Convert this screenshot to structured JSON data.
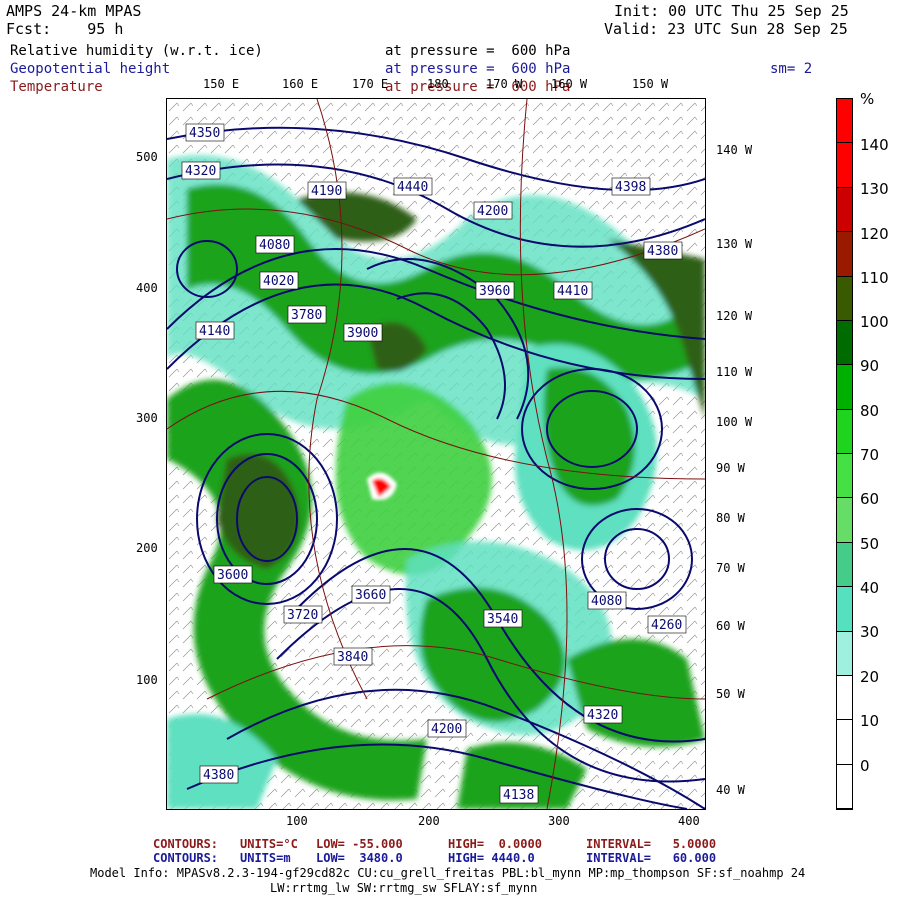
{
  "header": {
    "model": "AMPS 24-km MPAS",
    "fcst": "Fcst:    95 h",
    "init": "Init: 00 UTC Thu 25 Sep 25",
    "valid": "Valid: 23 UTC Sun 28 Sep 25",
    "smoothing": "sm= 2"
  },
  "fields": [
    {
      "name": "Relative humidity (w.r.t. ice)",
      "level": "at pressure =  600 hPa",
      "color": "#000000"
    },
    {
      "name": "Geopotential height",
      "level": "at pressure =  600 hPa",
      "color": "#1a1a9a"
    },
    {
      "name": "Temperature",
      "level": "at pressure =  600 hPa",
      "color": "#8b1a1a"
    }
  ],
  "map": {
    "top_lon_labels": [
      "150 E",
      "160 E",
      "170 E",
      "180",
      "170 W",
      "160 W",
      "150 W"
    ],
    "right_lon_labels": [
      "140 W",
      "130 W",
      "120 W",
      "110 W",
      "100 W",
      "90 W",
      "80 W",
      "70 W",
      "60 W",
      "50 W",
      "40 W"
    ],
    "y_ticks": [
      "500",
      "400",
      "300",
      "200",
      "100"
    ],
    "x_ticks": [
      "100",
      "200",
      "300",
      "400"
    ],
    "height_labels": [
      "4350",
      "4320",
      "4380",
      "4190",
      "4440",
      "4200",
      "4080",
      "4020",
      "4140",
      "3780",
      "3900",
      "3960",
      "3840",
      "3660",
      "3720",
      "3600",
      "3540",
      "4260",
      "4398",
      "4320",
      "4080",
      "4200",
      "4380",
      "4410",
      "4138"
    ],
    "colors": {
      "green_dark": "#2e5f12",
      "green_mid": "#1aa31a",
      "green_light": "#3ecf3e",
      "aqua": "#5fe0c0",
      "contour": "#0a0a6e",
      "temp": "#7a1010"
    }
  },
  "colorbar": {
    "unit": "%",
    "labels": [
      "140",
      "130",
      "120",
      "110",
      "100",
      "90",
      "80",
      "70",
      "60",
      "50",
      "40",
      "30",
      "20",
      "10",
      "0"
    ],
    "segments": [
      "#ff0000",
      "#ff0000",
      "#cc0000",
      "#9a1a00",
      "#3a5a00",
      "#006b00",
      "#00b000",
      "#1ed41e",
      "#44e044",
      "#66dd66",
      "#44cc88",
      "#55e0c0",
      "#a0f0e0",
      "#ffffff",
      "#ffffff",
      "#ffffff"
    ]
  },
  "footer": {
    "line1_label": "CONTOURS:",
    "line1_units": "UNITS=°C",
    "line1_low": "LOW= -55.000",
    "line1_high": "HIGH=  0.0000",
    "line1_interval": "INTERVAL=   5.0000",
    "line2_label": "CONTOURS:",
    "line2_units": "UNITS=m",
    "line2_low": "LOW=  3480.0",
    "line2_high": "HIGH= 4440.0",
    "line2_interval": "INTERVAL=   60.000",
    "model_info": "Model Info: MPASv8.2.3-194-gf29cd82c CU:cu_grell_freitas PBL:bl_mynn MP:mp_thompson SF:sf_noahmp 24",
    "model_info2": "LW:rrtmg_lw SW:rrtmg_sw SFLAY:sf_mynn"
  }
}
